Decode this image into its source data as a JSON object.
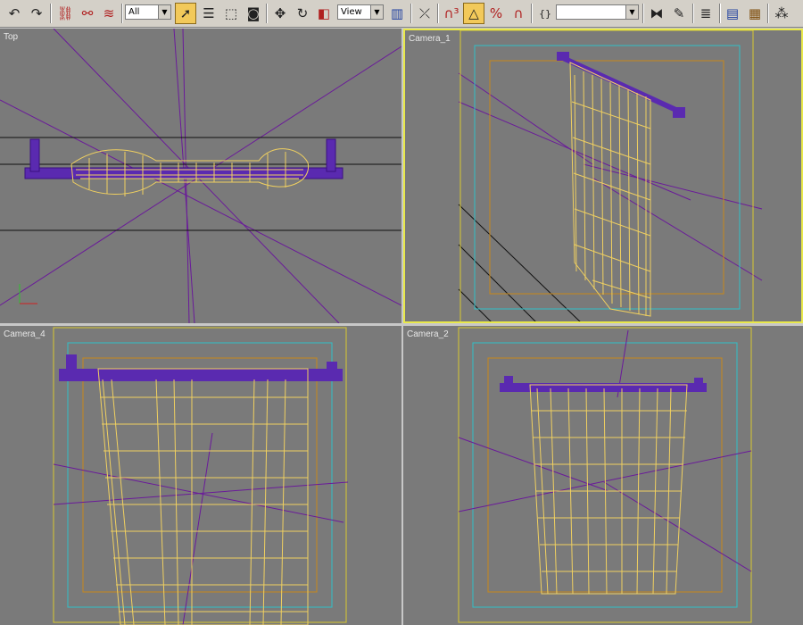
{
  "toolbar": {
    "selection_filter": "All",
    "reference_coord": "View",
    "named_selection": "",
    "icons": [
      "undo-icon",
      "redo-icon",
      "link-icon",
      "unlink-icon",
      "bind-space-warp-icon",
      "select-object-icon",
      "select-by-name-icon",
      "rectangle-select-icon",
      "window-crossing-icon",
      "move-icon",
      "rotate-icon",
      "scale-icon",
      "pivot-center-icon",
      "manipulate-icon",
      "snap-3d-icon",
      "angle-snap-icon",
      "percent-snap-icon",
      "spinner-snap-icon",
      "edit-named-selections-icon",
      "mirror-icon",
      "align-icon",
      "layer-manager-icon",
      "curve-editor-icon",
      "schematic-view-icon",
      "material-editor-icon"
    ]
  },
  "viewports": {
    "top_left": {
      "label": "Top"
    },
    "top_right": {
      "label": "Camera_1"
    },
    "bottom_left": {
      "label": "Camera_4"
    },
    "bottom_right": {
      "label": "Camera_2"
    }
  },
  "colors": {
    "viewport_bg": "#7a7a7a",
    "active_border": "#e8e84a",
    "wire_yellow": "#f0d060",
    "rod_purple": "#5a2ab0",
    "line_purple": "#6a1a9a",
    "safe_frame_cyan": "#30c0c8",
    "safe_frame_orange": "#c8881a",
    "frame_yellow": "#d8c830"
  }
}
